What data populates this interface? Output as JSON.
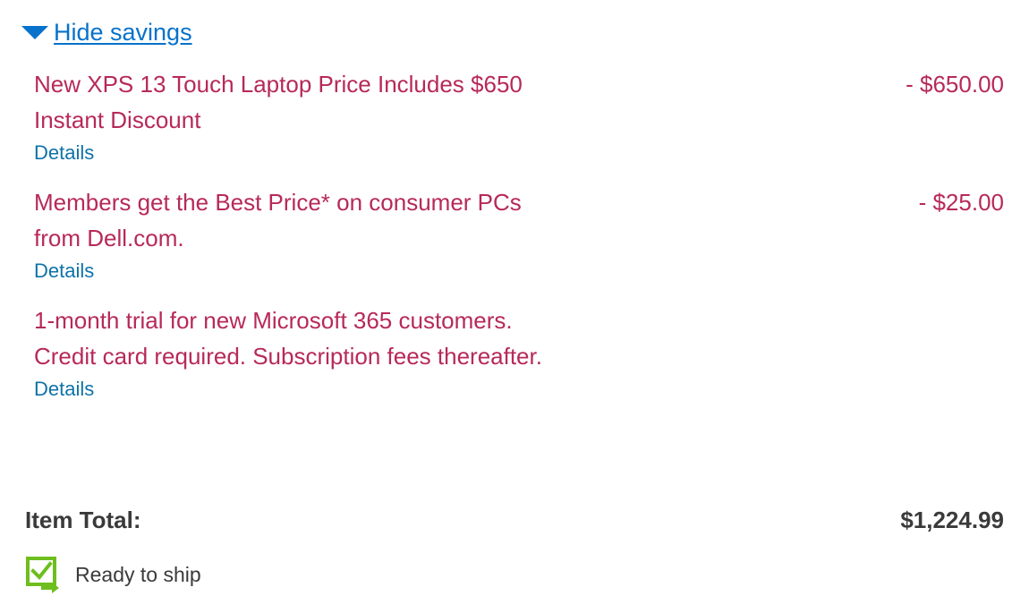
{
  "savings_toggle": {
    "label": "Hide savings",
    "icon": "caret-down-icon"
  },
  "savings": [
    {
      "description": "New XPS 13 Touch Laptop Price Includes $650 Instant Discount",
      "details_label": "Details",
      "amount": "- $650.00"
    },
    {
      "description": "Members get the Best Price* on consumer PCs from Dell.com.",
      "details_label": "Details",
      "amount": "- $25.00"
    },
    {
      "description": "1-month trial for new Microsoft 365 customers. Credit card required. Subscription fees thereafter.",
      "details_label": "Details",
      "amount": ""
    }
  ],
  "item_total": {
    "label": "Item Total:",
    "value": "$1,224.99"
  },
  "shipping": {
    "status": "Ready to ship",
    "icon": "ready-to-ship-icon"
  },
  "colors": {
    "link": "#0672cb",
    "savings_text": "#b7295a",
    "details_link": "#0e72a7",
    "body_text": "#3a3a3a",
    "ship_icon": "#6ebe1e"
  }
}
